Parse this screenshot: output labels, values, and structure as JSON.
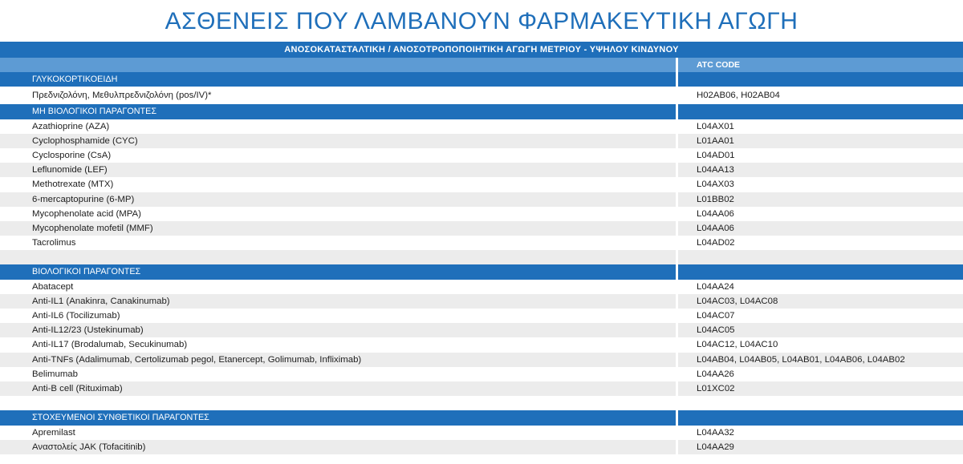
{
  "title": "ΑΣΘΕΝΕΙΣ ΠΟΥ ΛΑΜΒΑΝΟΥΝ ΦΑΡΜΑΚΕΥΤΙΚΗ ΑΓΩΓΗ",
  "banner": "ΑΝΟΣΟΚΑΤΑΣΤΑΛΤΙΚΗ / ΑΝΟΣΟΤΡΟΠΟΠΟΙΗΤΙΚΗ ΑΓΩΓΗ ΜΕΤΡΙΟΥ - ΥΨΗΛΟΥ ΚΙΝΔΥΝΟΥ",
  "header": {
    "col1": "",
    "col2": "ATC CODE"
  },
  "sections": [
    {
      "name": "ΓΛΥΚΟΚΟΡΤΙΚΟΕΙΔΗ",
      "rows": [
        {
          "drug": "Πρεδνιζολόνη, Μεθυλπρεδνιζολόνη (pos/IV)*",
          "atc": "H02AB06, H02AB04"
        }
      ]
    },
    {
      "name": "ΜΗ ΒΙΟΛΟΓΙΚΟΙ ΠΑΡΑΓΟΝΤΕΣ",
      "rows": [
        {
          "drug": "Azathioprine (AZA)",
          "atc": "L04AX01"
        },
        {
          "drug": "Cyclophosphamide (CYC)",
          "atc": "L01AA01"
        },
        {
          "drug": "Cyclosporine (CsA)",
          "atc": "L04AD01"
        },
        {
          "drug": "Leflunomide (LEF)",
          "atc": "L04AA13"
        },
        {
          "drug": "Methotrexate (MTX)",
          "atc": "L04AX03"
        },
        {
          "drug": "6-mercaptopurine (6-MP)",
          "atc": "L01BB02"
        },
        {
          "drug": "Mycophenolate acid (MPA)",
          "atc": "L04AA06"
        },
        {
          "drug": "Mycophenolate mofetil (MMF)",
          "atc": "L04AA06"
        },
        {
          "drug": "Tacrolimus",
          "atc": "L04AD02"
        }
      ]
    },
    {
      "name": "ΒΙΟΛΟΓΙΚΟΙ ΠΑΡΑΓΟΝΤΕΣ",
      "rows": [
        {
          "drug": "Abatacept",
          "atc": "L04AA24"
        },
        {
          "drug": "Anti-IL1 (Anakinra, Canakinumab)",
          "atc": "L04AC03, L04AC08"
        },
        {
          "drug": "Anti-IL6 (Tocilizumab)",
          "atc": "L04AC07"
        },
        {
          "drug": "Anti-IL12/23 (Ustekinumab)",
          "atc": "L04AC05"
        },
        {
          "drug": "Anti-IL17 (Brodalumab, Secukinumab)",
          "atc": "L04AC12, L04AC10"
        },
        {
          "drug": "Anti-TNFs (Adalimumab, Certolizumab pegol, Etanercept, Golimumab, Infliximab)",
          "atc": "L04AB04, L04AB05, L04AB01, L04AB06, L04AB02"
        },
        {
          "drug": "Belimumab",
          "atc": "L04AA26"
        },
        {
          "drug": "Anti-B cell (Rituximab)",
          "atc": "L01XC02"
        }
      ]
    },
    {
      "name": "ΣΤΟΧΕΥΜΕΝΟΙ ΣΥΝΘΕΤΙΚΟΙ ΠΑΡΑΓΟΝΤΕΣ",
      "rows": [
        {
          "drug": "Apremilast",
          "atc": "L04AA32"
        },
        {
          "drug": "Αναστολείς JAK (Tofacitinib)",
          "atc": "L04AA29"
        }
      ]
    }
  ]
}
